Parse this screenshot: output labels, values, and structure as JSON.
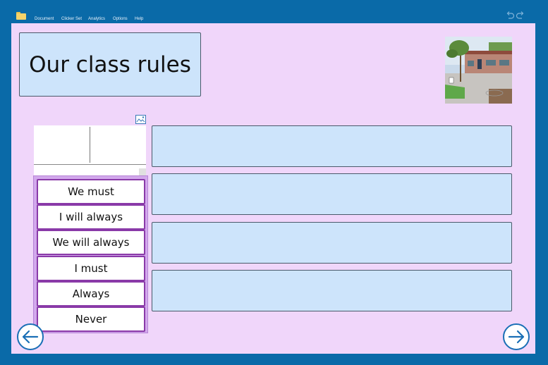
{
  "menu": {
    "items": [
      "Document",
      "Clicker Set",
      "Analytics",
      "Options",
      "Help"
    ]
  },
  "colors": {
    "frame": "#0a6aa8",
    "page": "#f0d6fa",
    "box_fill": "#cde4fb",
    "word_border": "#8a3aa8",
    "word_list_bg": "#d2a8ec"
  },
  "title": {
    "text": "Our class rules"
  },
  "word_list": {
    "items": [
      "We must",
      "I will always",
      "We will always",
      "I must",
      "Always",
      "Never"
    ]
  },
  "icons": {
    "folder": "folder-icon",
    "undo": "undo-icon",
    "redo": "redo-icon",
    "image": "image-icon",
    "back": "arrow-left-icon",
    "forward": "arrow-right-icon"
  }
}
